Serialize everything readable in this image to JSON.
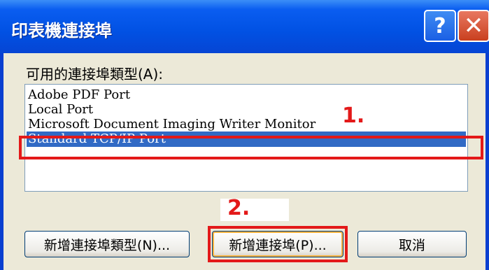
{
  "window": {
    "title": "印表機連接埠"
  },
  "titlebar": {
    "help_label": "?",
    "close_label": "✕"
  },
  "group": {
    "label": "可用的連接埠類型(A):"
  },
  "port_types": [
    {
      "label": "Adobe PDF Port",
      "selected": false
    },
    {
      "label": "Local Port",
      "selected": false
    },
    {
      "label": "Microsoft Document Imaging Writer Monitor",
      "selected": false
    },
    {
      "label": "Standard TCP/IP Port",
      "selected": true
    }
  ],
  "annotations": {
    "step1": "1.",
    "step2": "2.",
    "highlight_color": "#e31919"
  },
  "buttons": {
    "add_port_type": "新增連接埠類型(N)...",
    "add_port": "新增連接埠(P)...",
    "cancel": "取消"
  },
  "colors": {
    "selection": "#316ac5",
    "title_bar": "#0151e3",
    "dialog_face": "#ece9d8"
  }
}
